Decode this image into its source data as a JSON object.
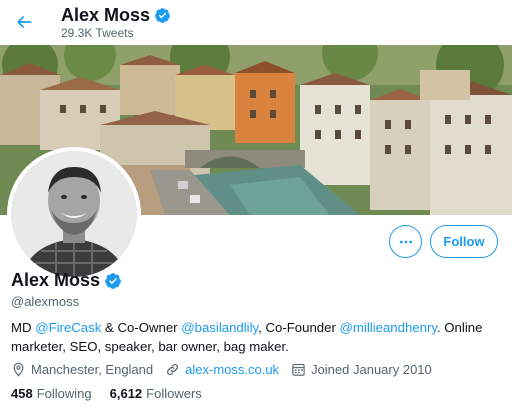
{
  "header": {
    "name": "Alex Moss",
    "tweet_count": "29.3K Tweets"
  },
  "profile": {
    "name": "Alex Moss",
    "handle": "@alexmoss",
    "follow_label": "Follow",
    "more_label": "•••",
    "bio": {
      "t1": "MD ",
      "l1": "@FireCask",
      "t2": " & Co-Owner ",
      "l2": "@basilandlily",
      "t3": ", Co-Founder ",
      "l3": "@millieandhenry",
      "t4": ". Online marketer, SEO, speaker, bar owner, bag maker."
    },
    "location": "Manchester, England",
    "website": "alex-moss.co.uk",
    "joined": "Joined January 2010",
    "following_count": "458",
    "following_label": "Following",
    "followers_count": "6,612",
    "followers_label": "Followers"
  },
  "colors": {
    "accent": "#1d9bf0",
    "text": "#0f1419",
    "muted": "#536471"
  },
  "icons": {
    "back": "arrow-left-icon",
    "verified": "verified-badge-icon",
    "more": "more-horizontal-icon",
    "location": "location-pin-icon",
    "link": "link-icon",
    "calendar": "calendar-icon"
  }
}
